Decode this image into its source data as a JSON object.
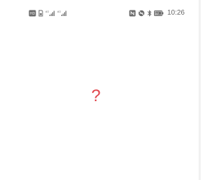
{
  "status_bar": {
    "time": "10:26",
    "network_signal_label_1": "4G",
    "network_signal_label_2": "4G",
    "icons": [
      "volte-icon",
      "sim-icon",
      "signal-strength-icon",
      "signal-strength-icon",
      "nfc-icon",
      "do-not-disturb-icon",
      "bluetooth-icon",
      "battery-icon"
    ],
    "battery_level": "97"
  },
  "content": {
    "placeholder_glyph": "?"
  },
  "colors": {
    "background": "#ffffff",
    "status_icon": "#5f5f5f",
    "accent_question_mark": "#e0454c"
  }
}
